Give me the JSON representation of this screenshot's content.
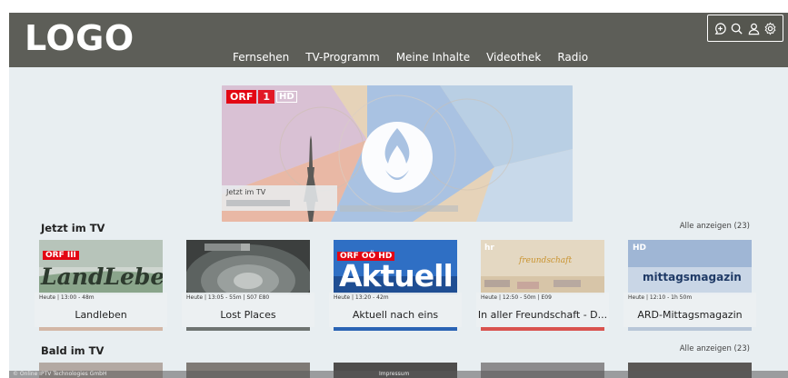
{
  "header": {
    "logo": "LOGO",
    "nav": [
      "Fernsehen",
      "TV-Programm",
      "Meine Inhalte",
      "Videothek",
      "Radio"
    ],
    "icons": [
      "add-chat-icon",
      "search-icon",
      "user-icon",
      "gear-icon"
    ]
  },
  "hero": {
    "channel_logo": "ORF",
    "channel_num": "1",
    "channel_hd": "HD",
    "caption_label": "Jetzt im TV"
  },
  "sections": {
    "now": {
      "title": "Jetzt im TV",
      "see_all": "Alle anzeigen (23)"
    },
    "soon": {
      "title": "Bald im TV",
      "see_all": "Alle anzeigen (23)"
    }
  },
  "cards": [
    {
      "channel": "ORF III",
      "art_text": "LandLeben",
      "meta": "Heute | 13:00 - 48m",
      "title": "Landleben",
      "color": "#c23b22"
    },
    {
      "channel": "",
      "art_text": "",
      "meta": "Heute | 13:05 - 55m | S07 E80",
      "title": "Lost Places",
      "color": "#5a5a5a"
    },
    {
      "channel": "ORF OÖ HD",
      "art_text": "Aktuell",
      "meta": "Heute | 13:20 - 42m",
      "title": "Aktuell nach eins",
      "color": "#3a7bd5"
    },
    {
      "channel": "hr",
      "art_text": "freundschaft",
      "meta": "Heute | 12:50 - 50m | E09",
      "title": "In aller Freundschaft - D...",
      "color": "#d9534f"
    },
    {
      "channel": "HD",
      "art_text": "mittagsmagazin",
      "meta": "Heute | 12:10 - 1h 50m",
      "title": "ARD-Mittagsmagazin",
      "color": "#2b5ea7"
    }
  ],
  "footer": {
    "copyright": "© Online IPTV Technologies GmbH",
    "imprint": "Impressum"
  }
}
